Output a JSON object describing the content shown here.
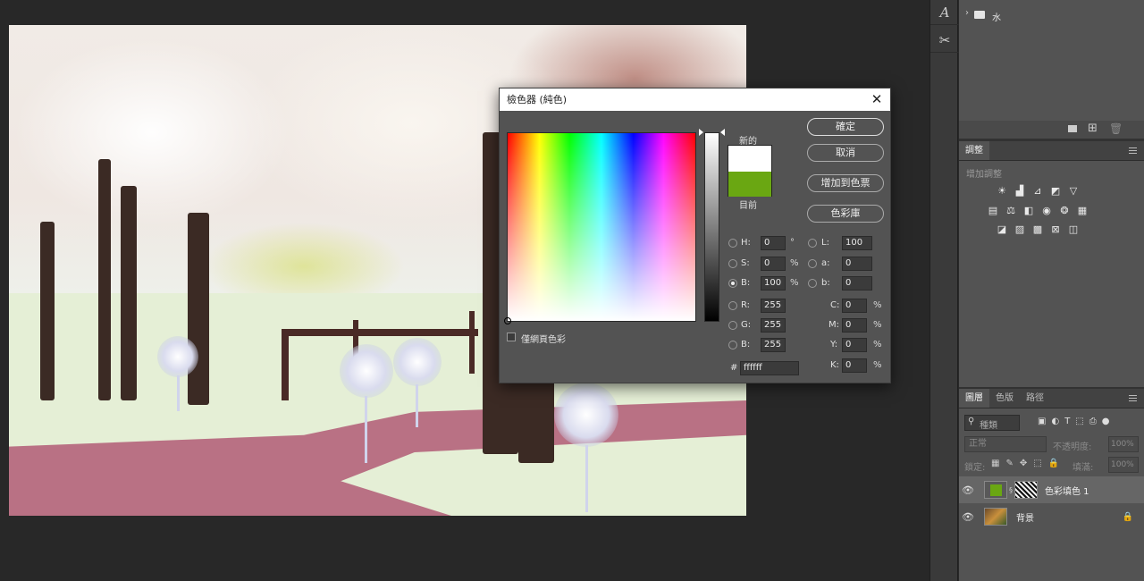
{
  "folder": {
    "name": "水"
  },
  "adjustments": {
    "tab": "調整",
    "subtitle": "增加調整"
  },
  "layers_panel": {
    "tabs": [
      "圖層",
      "色版",
      "路徑"
    ],
    "search_placeholder": "種類",
    "blend_mode": "正常",
    "opacity_label": "不透明度:",
    "opacity_value": "100%",
    "lock_label": "鎖定:",
    "fill_label": "填滿:",
    "fill_value": "100%",
    "layers": [
      {
        "name": "色彩填色 1",
        "fill_color": "#6aa712"
      },
      {
        "name": "背景"
      }
    ]
  },
  "dialog": {
    "title": "檢色器 (純色)",
    "ok": "確定",
    "cancel": "取消",
    "add_swatch": "增加到色票",
    "library": "色彩庫",
    "new_label": "新的",
    "current_label": "目前",
    "new_color": "#ffffff",
    "current_color": "#6aa712",
    "web_only": "僅網頁色彩",
    "fields": {
      "H": {
        "label": "H:",
        "value": "0",
        "unit": "°"
      },
      "S": {
        "label": "S:",
        "value": "0",
        "unit": "%"
      },
      "B": {
        "label": "B:",
        "value": "100",
        "unit": "%"
      },
      "R": {
        "label": "R:",
        "value": "255"
      },
      "G": {
        "label": "G:",
        "value": "255"
      },
      "Bl": {
        "label": "B:",
        "value": "255"
      },
      "L": {
        "label": "L:",
        "value": "100"
      },
      "a": {
        "label": "a:",
        "value": "0"
      },
      "b": {
        "label": "b:",
        "value": "0"
      },
      "C": {
        "label": "C:",
        "value": "0",
        "unit": "%"
      },
      "M": {
        "label": "M:",
        "value": "0",
        "unit": "%"
      },
      "Y": {
        "label": "Y:",
        "value": "0",
        "unit": "%"
      },
      "K": {
        "label": "K:",
        "value": "0",
        "unit": "%"
      }
    },
    "hex_label": "#",
    "hex": "ffffff"
  }
}
